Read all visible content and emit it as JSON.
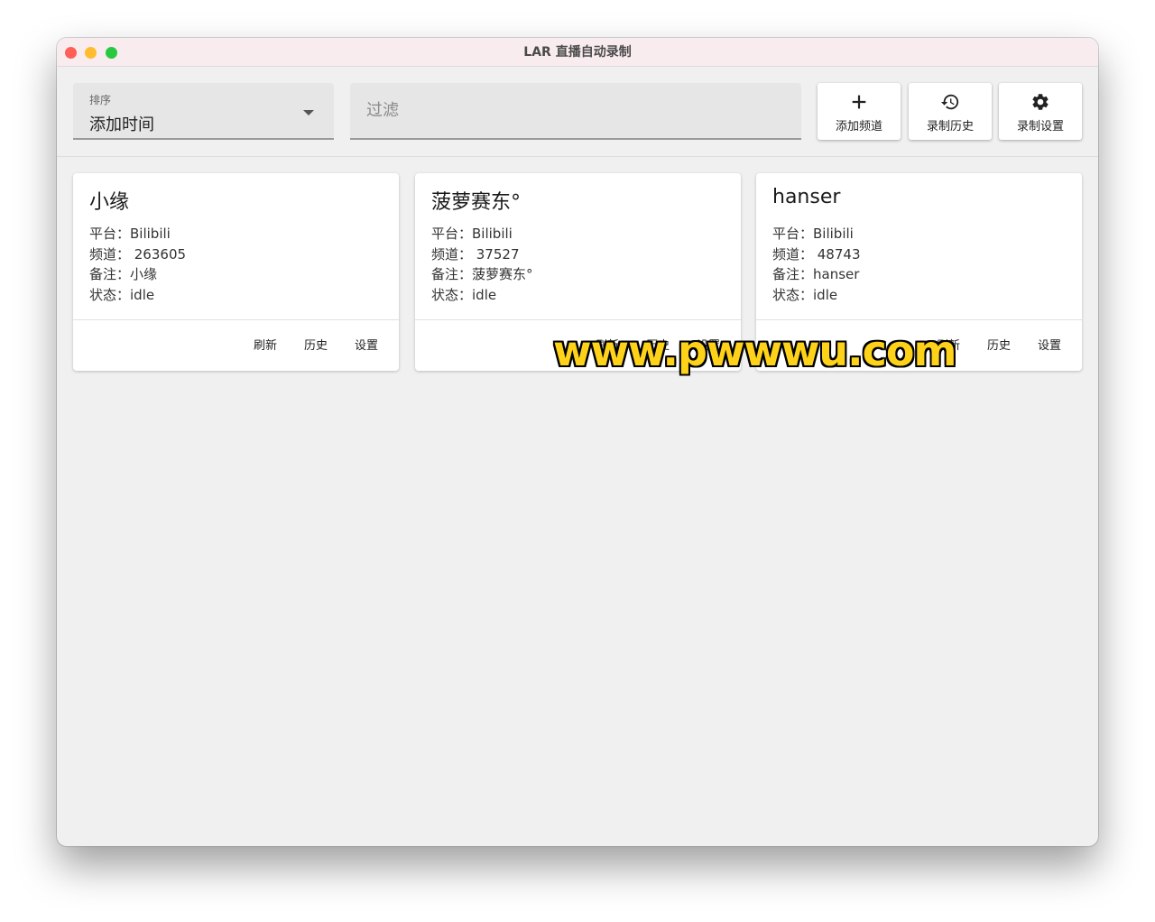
{
  "window": {
    "title": "LAR 直播自动录制"
  },
  "toolbar": {
    "sort": {
      "label": "排序",
      "value": "添加时间"
    },
    "filter": {
      "placeholder": "过滤",
      "value": ""
    },
    "buttons": [
      {
        "label": "添加频道",
        "icon": "plus-icon"
      },
      {
        "label": "录制历史",
        "icon": "history-icon"
      },
      {
        "label": "录制设置",
        "icon": "gear-icon"
      }
    ]
  },
  "cards": [
    {
      "name": "小缘",
      "rows": [
        "平台：Bilibili",
        "频道：  263605",
        "备注：小缘",
        "状态：idle"
      ],
      "actions": [
        "刷新",
        "历史",
        "设置"
      ]
    },
    {
      "name": "菠萝赛东°",
      "rows": [
        "平台：Bilibili",
        "频道：  37527",
        "备注：菠萝赛东°",
        "状态：idle"
      ],
      "actions": [
        "刷新",
        "历史",
        "设置"
      ]
    },
    {
      "name": "hanser",
      "rows": [
        "平台：Bilibili",
        "频道：  48743",
        "备注：hanser",
        "状态：idle"
      ],
      "actions": [
        "刷新",
        "历史",
        "设置"
      ]
    }
  ],
  "watermark": "www.pwwwu.com",
  "colors": {
    "window_bg": "#f0f0f0",
    "titlebar_bg": "#f9ecee",
    "card_bg": "#ffffff"
  }
}
